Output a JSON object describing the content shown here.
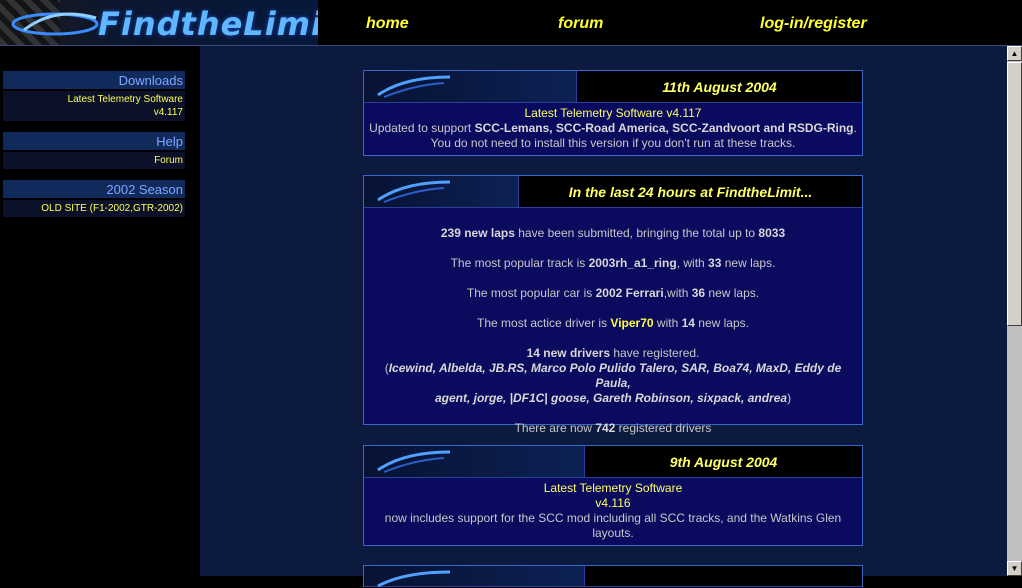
{
  "header": {
    "logo_text": "FindtheLimit",
    "nav": [
      "home",
      "forum",
      "log-in/register"
    ]
  },
  "sidebar": {
    "groups": [
      {
        "title": "Downloads",
        "items": [
          "Latest Telemetry Software v4.117"
        ]
      },
      {
        "title": "Help",
        "items": [
          "Forum"
        ]
      },
      {
        "title": "2002 Season",
        "items": [
          "OLD SITE (F1-2002,GTR-2002)"
        ]
      }
    ]
  },
  "cards": [
    {
      "date": "11th August 2004",
      "link": "Latest Telemetry Software v4.117",
      "line1_prefix": "Updated to support ",
      "line1_bold": "SCC-Lemans, SCC-Road America, SCC-Zandvoort and RSDG-Ring",
      "line1_suffix": ".",
      "line2": "You do not need to install this version if you don't run at these tracks."
    },
    {
      "date": "In the last 24 hours at FindtheLimit...",
      "laps_count": "239 new laps",
      "laps_text": " have been submitted, bringing the total up to ",
      "laps_total": "8033",
      "track_prefix": "The most popular track is ",
      "track_name": "2003rh_a1_ring",
      "track_mid": ", with ",
      "track_laps": "33",
      "track_suffix": " new laps.",
      "car_prefix": "The most popular car is ",
      "car_name": "2002 Ferrari",
      "car_mid": ",with ",
      "car_laps": "36",
      "car_suffix": " new laps.",
      "driver_prefix": "The most actice driver is ",
      "driver_name": "Viper70",
      "driver_mid": " with ",
      "driver_laps": "14",
      "driver_suffix": " new laps.",
      "new_drivers": "14 new drivers",
      "new_drivers_text": " have registered.",
      "driver_list_line1": "Icewind, Albelda, JB.RS, Marco Polo Pulido Talero, SAR, Boa74, MaxD, Eddy de Paula,",
      "driver_list_line2": "agent, jorge, |DF1C| goose, Gareth Robinson, sixpack, andrea",
      "total_prefix": "There are now ",
      "total_count": "742",
      "total_suffix": " registered drivers"
    },
    {
      "date": "9th August 2004",
      "link_line1": "Latest Telemetry Software",
      "link_line2": "v4.116",
      "desc": "now includes support for the SCC mod including all SCC tracks, and the Watkins Glen layouts."
    }
  ],
  "colors": {
    "accent_yellow": "#ffff66",
    "card_bg": "#0a0a5e",
    "content_bg": "#0b1a3e",
    "card_border": "#3a67c8"
  }
}
